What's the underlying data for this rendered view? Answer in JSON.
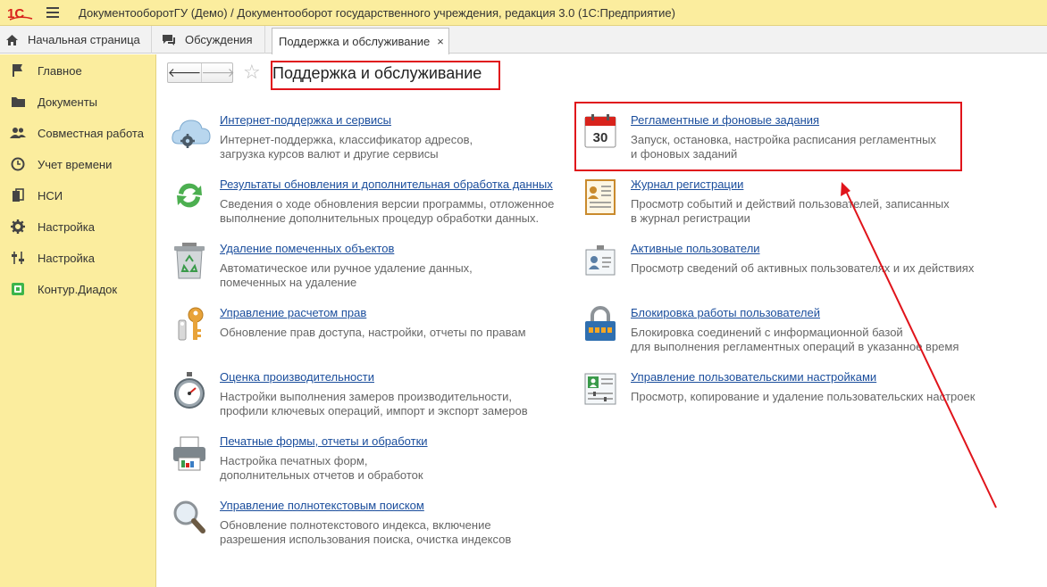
{
  "titlebar": {
    "title": "ДокументооборотГУ (Демо) / Документооборот государственного учреждения, редакция 3.0  (1С:Предприятие)"
  },
  "tabs": [
    {
      "label": "Начальная страница"
    },
    {
      "label": "Обсуждения"
    },
    {
      "label": "Поддержка и обслуживание",
      "close": "×"
    }
  ],
  "sidebar": {
    "items": [
      {
        "label": "Главное",
        "icon": "flag-icon"
      },
      {
        "label": "Документы",
        "icon": "folder-icon"
      },
      {
        "label": "Совместная работа",
        "icon": "people-icon"
      },
      {
        "label": "Учет времени",
        "icon": "clock-icon"
      },
      {
        "label": "НСИ",
        "icon": "books-icon"
      },
      {
        "label": "Настройка",
        "icon": "gear-icon"
      },
      {
        "label": "Настройка",
        "icon": "sliders-icon"
      },
      {
        "label": "Контур.Диадок",
        "icon": "diadoc-icon"
      }
    ]
  },
  "page": {
    "title": "Поддержка и обслуживание",
    "back": "🡐",
    "forward": "🡒",
    "star": "☆"
  },
  "left_column": [
    {
      "title": "Интернет-поддержка и сервисы",
      "desc1": "Интернет-поддержка, классификатор адресов,",
      "desc2": "загрузка курсов валют и другие сервисы",
      "icon": "cloud-gear-icon"
    },
    {
      "title": "Результаты обновления и дополнительная обработка данных",
      "desc1": "Сведения о ходе обновления версии программы, отложенное",
      "desc2": "выполнение дополнительных процедур обработки данных.",
      "icon": "refresh-icon"
    },
    {
      "title": "Удаление помеченных объектов",
      "desc1": "Автоматическое или ручное удаление данных,",
      "desc2": "помеченных на удаление",
      "icon": "recycle-bin-icon"
    },
    {
      "title": "Управление расчетом прав",
      "desc1": "Обновление прав доступа, настройки, отчеты по правам",
      "desc2": "",
      "icon": "keys-icon"
    },
    {
      "title": "Оценка производительности",
      "desc1": "Настройки выполнения замеров производительности,",
      "desc2": "профили ключевых операций, импорт и экспорт замеров",
      "icon": "stopwatch-icon"
    },
    {
      "title": "Печатные формы, отчеты и обработки",
      "desc1": "Настройка печатных форм,",
      "desc2": "дополнительных отчетов и обработок",
      "icon": "printer-icon"
    },
    {
      "title": "Управление полнотекстовым поиском",
      "desc1": "Обновление полнотекстового индекса, включение",
      "desc2": "разрешения использования поиска, очистка индексов",
      "icon": "magnifier-icon"
    }
  ],
  "right_column": [
    {
      "title": "Регламентные и фоновые задания",
      "desc1": "Запуск, остановка, настройка расписания регламентных",
      "desc2": "и фоновых заданий",
      "icon": "calendar-icon",
      "calendar_day": "30"
    },
    {
      "title": "Журнал регистрации",
      "desc1": "Просмотр событий и действий пользователей, записанных",
      "desc2": "в журнал регистрации",
      "icon": "journal-icon"
    },
    {
      "title": "Активные пользователи",
      "desc1": "Просмотр сведений об активных пользователях и их действиях",
      "desc2": "",
      "icon": "badge-icon"
    },
    {
      "title": "Блокировка работы пользователей",
      "desc1": "Блокировка соединений с информационной базой",
      "desc2": "для выполнения регламентных операций в указанное время",
      "icon": "padlock-icon"
    },
    {
      "title": "Управление пользовательскими настройками",
      "desc1": "Просмотр, копирование и удаление пользовательских настроек",
      "desc2": "",
      "icon": "user-settings-icon"
    }
  ],
  "colors": {
    "accent_yellow": "#fbed9e",
    "link": "#1a4d9c",
    "highlight_red": "#e0141b"
  }
}
